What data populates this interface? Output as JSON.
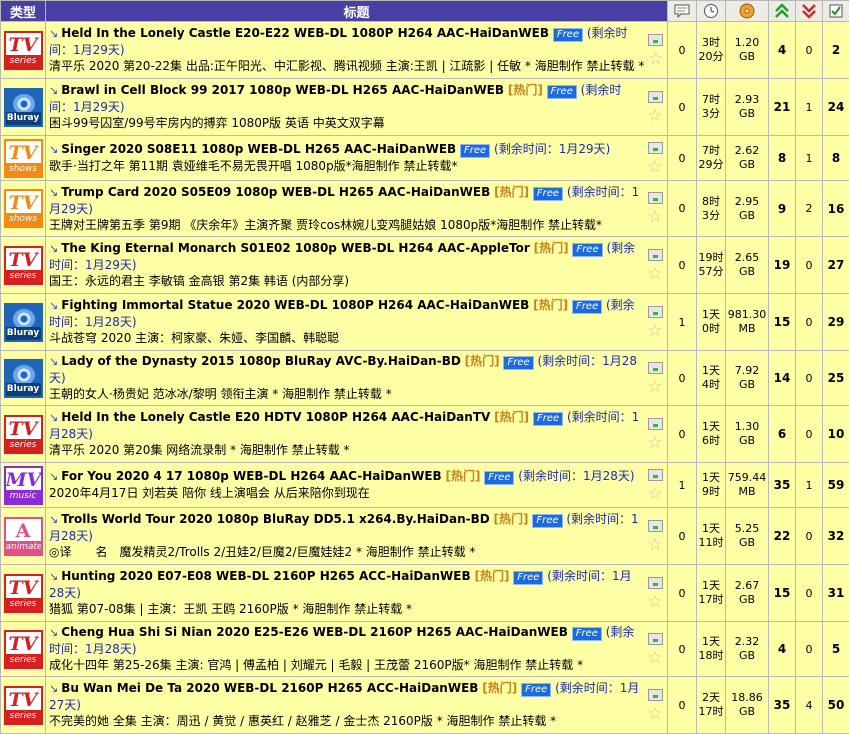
{
  "headers": {
    "category": "类型",
    "title": "标题"
  },
  "header_icons": [
    "comments-icon",
    "time-icon",
    "size-icon",
    "seeders-icon",
    "leechers-icon",
    "completed-icon"
  ],
  "free_label": "Free",
  "hot_label": "[热门]",
  "rows": [
    {
      "cat": "tv",
      "cat_big": "TV",
      "cat_small": "series",
      "name": "Held In the Lonely Castle E20-E22 WEB-DL 1080P H264 AAC-HaiDanWEB",
      "hot": false,
      "remain": "(剩余时间：1月29天)",
      "subtitle": "清平乐 2020 第20-22集 出品:正午阳光、中汇影视、腾讯视频 主演:王凯 | 江疏影 | 任敏 * 海胆制作 禁止转载 *",
      "comments": "0",
      "time": "3时\n20分",
      "size": "1.20\nGB",
      "seeders": "4",
      "leechers": "0",
      "completed": "2"
    },
    {
      "cat": "bluray",
      "cat_big": "",
      "cat_small": "Bluray",
      "name": "Brawl in Cell Block 99 2017 1080p WEB-DL H265 AAC-HaiDanWEB",
      "hot": true,
      "remain": "(剩余时间：1月29天)",
      "subtitle": "困斗99号囚室/99号牢房内的搏弈 1080P版 英语 中英文双字幕",
      "comments": "0",
      "time": "7时\n3分",
      "size": "2.93\nGB",
      "seeders": "21",
      "leechers": "1",
      "completed": "24"
    },
    {
      "cat": "shows",
      "cat_big": "TV",
      "cat_small": "shows",
      "name": "Singer 2020 S08E11 1080p WEB-DL H265 AAC-HaiDanWEB",
      "hot": false,
      "remain": "(剩余时间：1月29天)",
      "subtitle": "歌手·当打之年 第11期 袁娅维毛不易无畏开唱 1080p版*海胆制作 禁止转载*",
      "comments": "0",
      "time": "7时\n29分",
      "size": "2.62\nGB",
      "seeders": "8",
      "leechers": "1",
      "completed": "8"
    },
    {
      "cat": "shows",
      "cat_big": "TV",
      "cat_small": "shows",
      "name": "Trump Card 2020 S05E09 1080p WEB-DL H265 AAC-HaiDanWEB",
      "hot": true,
      "remain": "(剩余时间：1月29天)",
      "subtitle": "王牌对王牌第五季 第9期 《庆余年》主演齐聚 贾玲cos林婉儿变鸡腿姑娘 1080p版*海胆制作 禁止转载*",
      "comments": "0",
      "time": "8时\n3分",
      "size": "2.95\nGB",
      "seeders": "9",
      "leechers": "2",
      "completed": "16"
    },
    {
      "cat": "tv",
      "cat_big": "TV",
      "cat_small": "series",
      "name": "The King Eternal Monarch S01E02 1080p WEB-DL H264 AAC-AppleTor",
      "hot": true,
      "remain": "(剩余时间：1月29天)",
      "subtitle": "国王：永远的君主 李敏镐 金高银 第2集 韩语 (内部分享)",
      "comments": "0",
      "time": "19时\n57分",
      "size": "2.65\nGB",
      "seeders": "19",
      "leechers": "0",
      "completed": "27"
    },
    {
      "cat": "bluray",
      "cat_big": "",
      "cat_small": "Bluray",
      "name": "Fighting Immortal Statue 2020 WEB-DL 1080P H264 AAC-HaiDanWEB",
      "hot": true,
      "remain": "(剩余时间：1月28天)",
      "subtitle": "斗战苍穹 2020 主演：柯家豪、朱娅、李国麟、韩聪聪",
      "comments": "1",
      "time": "1天\n0时",
      "size": "981.30\nMB",
      "seeders": "15",
      "leechers": "0",
      "completed": "29"
    },
    {
      "cat": "bluray",
      "cat_big": "",
      "cat_small": "Bluray",
      "name": "Lady of the Dynasty 2015 1080p BluRay AVC-By.HaiDan-BD",
      "hot": true,
      "remain": "(剩余时间：1月28天)",
      "subtitle": "王朝的女人·杨贵妃 范冰冰/黎明 领衔主演 * 海胆制作 禁止转载 *",
      "comments": "0",
      "time": "1天\n4时",
      "size": "7.92\nGB",
      "seeders": "14",
      "leechers": "0",
      "completed": "25"
    },
    {
      "cat": "tv",
      "cat_big": "TV",
      "cat_small": "series",
      "name": "Held In the Lonely Castle E20 HDTV 1080P H264 AAC-HaiDanTV",
      "hot": true,
      "remain": "(剩余时间：1月28天)",
      "subtitle": "清平乐 2020 第20集 网络流录制 * 海胆制作 禁止转载 *",
      "comments": "0",
      "time": "1天\n6时",
      "size": "1.30\nGB",
      "seeders": "6",
      "leechers": "0",
      "completed": "10"
    },
    {
      "cat": "mv",
      "cat_big": "MV",
      "cat_small": "music",
      "name": "For You 2020 4 17 1080p WEB-DL H264 AAC-HaiDanWEB",
      "hot": true,
      "remain": "(剩余时间：1月28天)",
      "subtitle": "2020年4月17日 刘若英 陪你 线上演唱会 从后来陪你到现在",
      "comments": "1",
      "time": "1天\n9时",
      "size": "759.44\nMB",
      "seeders": "35",
      "leechers": "1",
      "completed": "59"
    },
    {
      "cat": "anim",
      "cat_big": "A",
      "cat_small": "animate",
      "name": "Trolls World Tour 2020 1080p BluRay DD5.1 x264.By.HaiDan-BD",
      "hot": true,
      "remain": "(剩余时间：1月28天)",
      "subtitle": "◎译　　名　魔发精灵2/Trolls 2/丑娃2/巨魔2/巨魔娃娃2 * 海胆制作 禁止转载 *",
      "comments": "0",
      "time": "1天\n11时",
      "size": "5.25\nGB",
      "seeders": "22",
      "leechers": "0",
      "completed": "32"
    },
    {
      "cat": "tv",
      "cat_big": "TV",
      "cat_small": "series",
      "name": "Hunting 2020 E07-E08 WEB-DL 2160P H265 ACC-HaiDanWEB",
      "hot": true,
      "remain": "(剩余时间：1月28天)",
      "subtitle": "猎狐 第07-08集 | 主演：王凯 王鸥 2160P版 * 海胆制作 禁止转载 *",
      "comments": "0",
      "time": "1天\n17时",
      "size": "2.67\nGB",
      "seeders": "15",
      "leechers": "0",
      "completed": "31"
    },
    {
      "cat": "tv",
      "cat_big": "TV",
      "cat_small": "series",
      "name": "Cheng Hua Shi Si Nian 2020 E25-E26 WEB-DL 2160P H265 AAC-HaiDanWEB",
      "hot": false,
      "remain": "(剩余时间：1月28天)",
      "subtitle": "成化十四年 第25-26集 主演: 官鸿 | 傅孟柏 | 刘耀元 | 毛毅 | 王茂蕾 2160P版* 海胆制作 禁止转载 *",
      "comments": "0",
      "time": "1天\n18时",
      "size": "2.32\nGB",
      "seeders": "4",
      "leechers": "0",
      "completed": "5"
    },
    {
      "cat": "tv",
      "cat_big": "TV",
      "cat_small": "series",
      "name": "Bu Wan Mei De Ta 2020 WEB-DL 2160P H265 ACC-HaiDanWEB",
      "hot": true,
      "remain": "(剩余时间：1月27天)",
      "subtitle": "不完美的她 全集 主演：周迅 / 黄觉 / 惠英红 / 赵雅芝 / 金士杰 2160P版 * 海胆制作 禁止转载 *",
      "comments": "0",
      "time": "2天\n17时",
      "size": "18.86\nGB",
      "seeders": "35",
      "leechers": "4",
      "completed": "50"
    }
  ]
}
